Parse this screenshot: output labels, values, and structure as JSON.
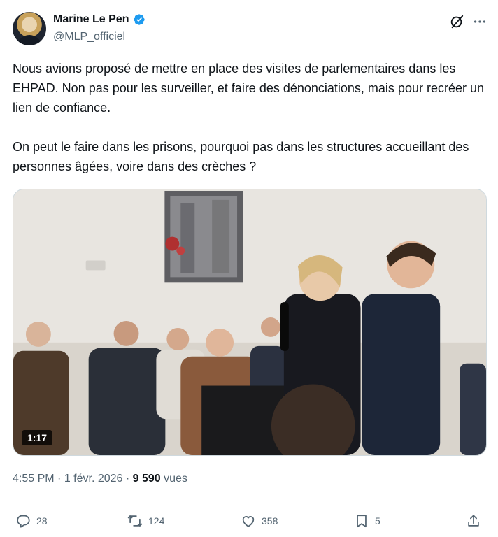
{
  "author": {
    "display_name": "Marine Le Pen",
    "handle": "@MLP_officiel",
    "verified_icon": "verified-badge-icon",
    "verified_color": "#1d9bf0"
  },
  "tweet": {
    "paragraphs": [
      "Nous avions proposé de mettre en place des visites de parlementaires dans les EHPAD. Non pas pour les surveiller, et faire des dénonciations, mais pour recréer un lien de confiance.",
      "On peut le faire dans les prisons, pourquoi pas dans les structures accueillant des personnes âgées, voire dans des crèches ?"
    ]
  },
  "media": {
    "type": "video",
    "duration": "1:17"
  },
  "meta": {
    "time": "4:55 PM",
    "separator": " · ",
    "date": "1 févr. 2026",
    "separator2": " · ",
    "views_count": "9 590",
    "views_label": " vues"
  },
  "actions": {
    "replies": "28",
    "reposts": "124",
    "likes": "358",
    "bookmarks": "5"
  },
  "colors": {
    "text": "#0f1419",
    "secondary": "#536471",
    "border": "#cfd9de"
  }
}
